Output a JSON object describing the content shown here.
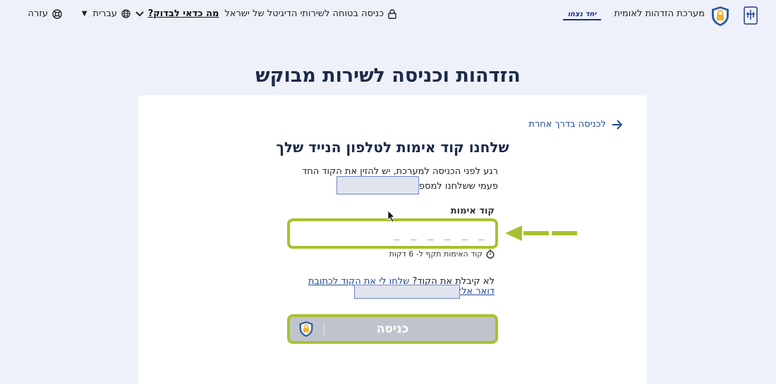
{
  "header": {
    "system_name": "מערכת הזדהות לאומית",
    "yahad_logo": "יחד נצחו",
    "secure_text": "כניסה בטוחה לשירותי הדיגיטל של ישראל",
    "worth_checking": "מה כדאי לבדוק?",
    "language": "עברית",
    "help": "עזרה"
  },
  "page_title": "הזדהות וכניסה לשירות מבוקש",
  "card": {
    "back_link": "לכניסה בדרך אחרת",
    "title": "שלחנו קוד אימות לטלפון הנייד שלך",
    "description": "רגע לפני הכניסה למערכת, יש להזין את הקוד החד פעמי ששלחנו למספר טלפון",
    "code_label": "קוד אימות",
    "code_placeholder": "_ _ _ _ _ _",
    "timer_text": "קוד האימות תקף ל- 6 דקות",
    "resend_prefix": "לא קיבלת את הקוד?",
    "resend_link": "שלחו לי את הקוד לכתובת דואר אלקטרוני",
    "submit_label": "כניסה"
  },
  "colors": {
    "highlight": "#a8c02f",
    "link": "#1f4c96",
    "title": "#1b2a4a",
    "background": "#eef1f9"
  },
  "icons": [
    "state-emblem-icon",
    "shield-lock-icon",
    "lock-icon",
    "chevron-down-icon",
    "globe-icon",
    "caret-down-icon",
    "lifebuoy-icon",
    "arrow-right-icon",
    "timer-icon",
    "mouse-cursor-icon"
  ]
}
